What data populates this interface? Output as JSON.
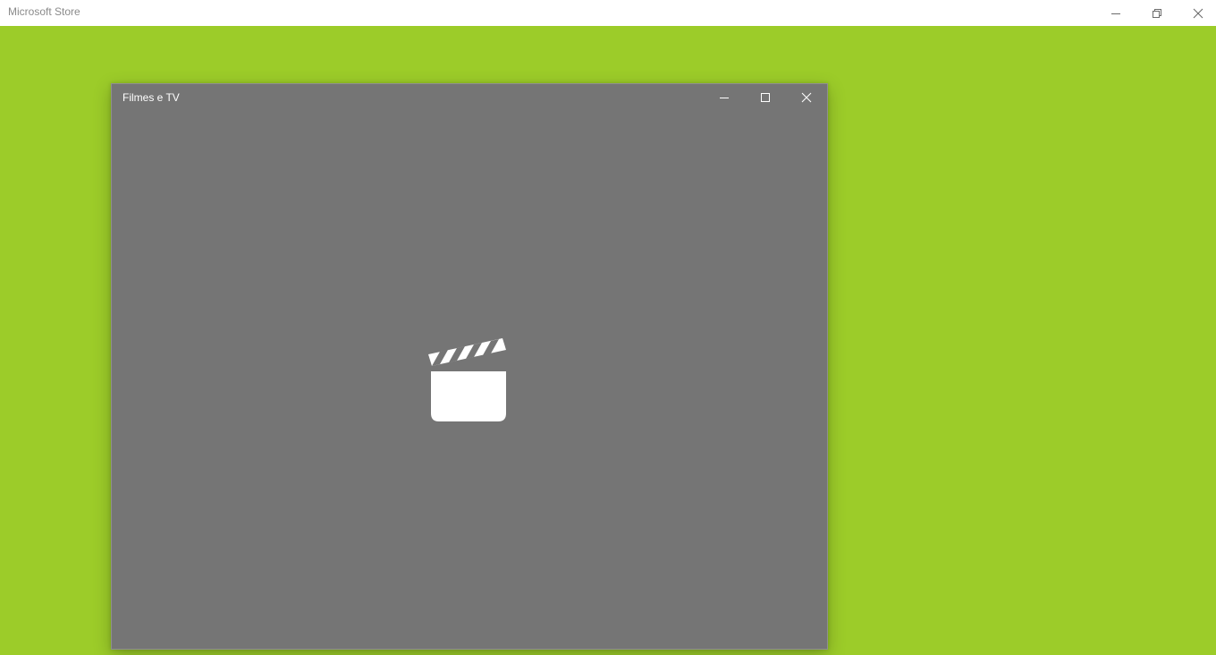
{
  "store_window": {
    "title": "Microsoft Store",
    "background_color": "#9ccc29",
    "titlebar_color": "#ffffff",
    "caption_buttons": {
      "minimize_icon": "minimize-icon",
      "restore_icon": "restore-icon",
      "close_icon": "close-icon"
    }
  },
  "splash_window": {
    "title": "Filmes e TV",
    "background_color": "#757575",
    "logo_icon": "clapperboard-icon",
    "caption_buttons": {
      "minimize_icon": "minimize-icon",
      "maximize_icon": "maximize-icon",
      "close_icon": "close-icon"
    }
  }
}
